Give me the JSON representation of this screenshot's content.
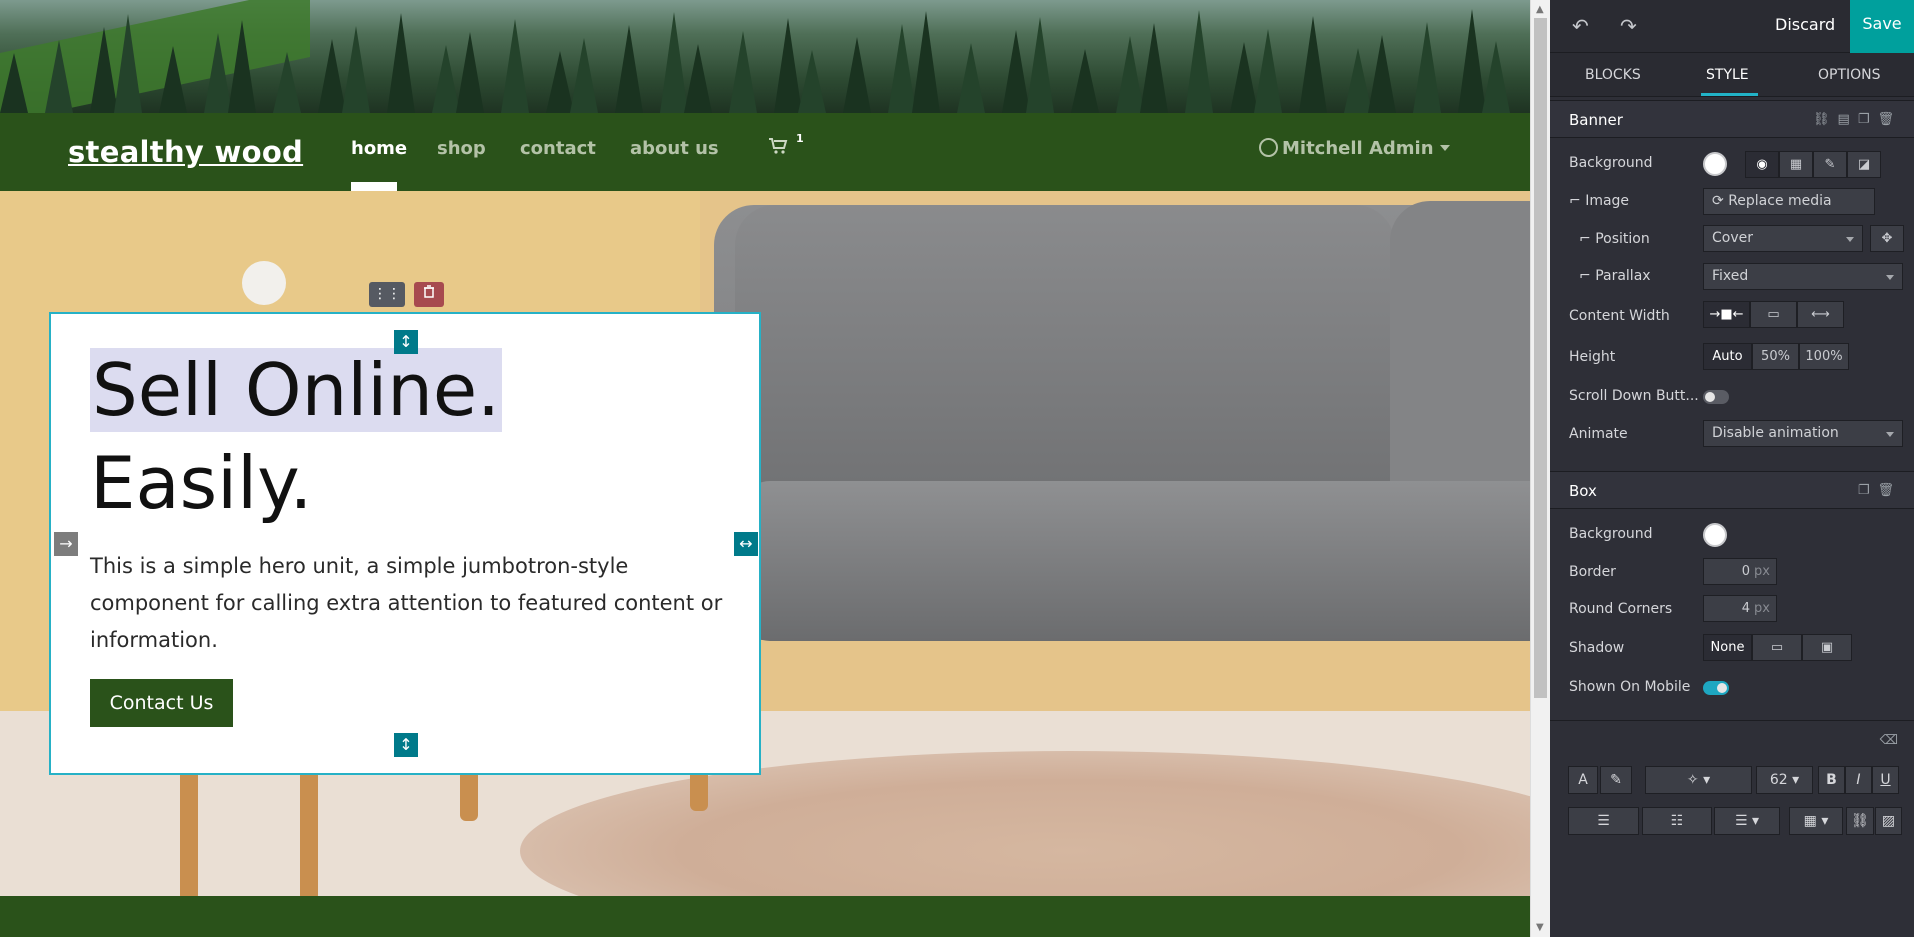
{
  "site": {
    "logo": "stealthy wood",
    "nav": [
      {
        "label": "home"
      },
      {
        "label": "shop"
      },
      {
        "label": "contact"
      },
      {
        "label": "about us"
      }
    ],
    "cart_count": "1",
    "user_name": "Mitchell Admin"
  },
  "hero": {
    "title_line1": "Sell Online.",
    "title_line2": "Easily.",
    "text": "This is a simple hero unit, a simple jumbotron-style component for calling extra attention to featured content or information.",
    "button_label": "Contact Us"
  },
  "editor": {
    "discard_label": "Discard",
    "save_label": "Save",
    "tabs": [
      "BLOCKS",
      "STYLE",
      "OPTIONS"
    ],
    "banner": {
      "title": "Banner",
      "background_label": "Background",
      "image_label": "Image",
      "replace_media": "Replace media",
      "position_label": "Position",
      "position_value": "Cover",
      "parallax_label": "Parallax",
      "parallax_value": "Fixed",
      "content_width_label": "Content Width",
      "height_label": "Height",
      "height_options": [
        "Auto",
        "50%",
        "100%"
      ],
      "scroll_down_label": "Scroll Down Butt...",
      "animate_label": "Animate",
      "animate_value": "Disable animation"
    },
    "box": {
      "title": "Box",
      "background_label": "Background",
      "border_label": "Border",
      "border_value": "0",
      "round_corners_label": "Round Corners",
      "round_corners_value": "4",
      "unit": "px",
      "shadow_label": "Shadow",
      "shadow_none": "None",
      "shown_on_mobile_label": "Shown On Mobile"
    },
    "rte": {
      "font_size": "62"
    }
  },
  "colors": {
    "header_green": "#2a521a",
    "accent_teal": "#00a09d",
    "selection_border": "#26b1c6"
  }
}
